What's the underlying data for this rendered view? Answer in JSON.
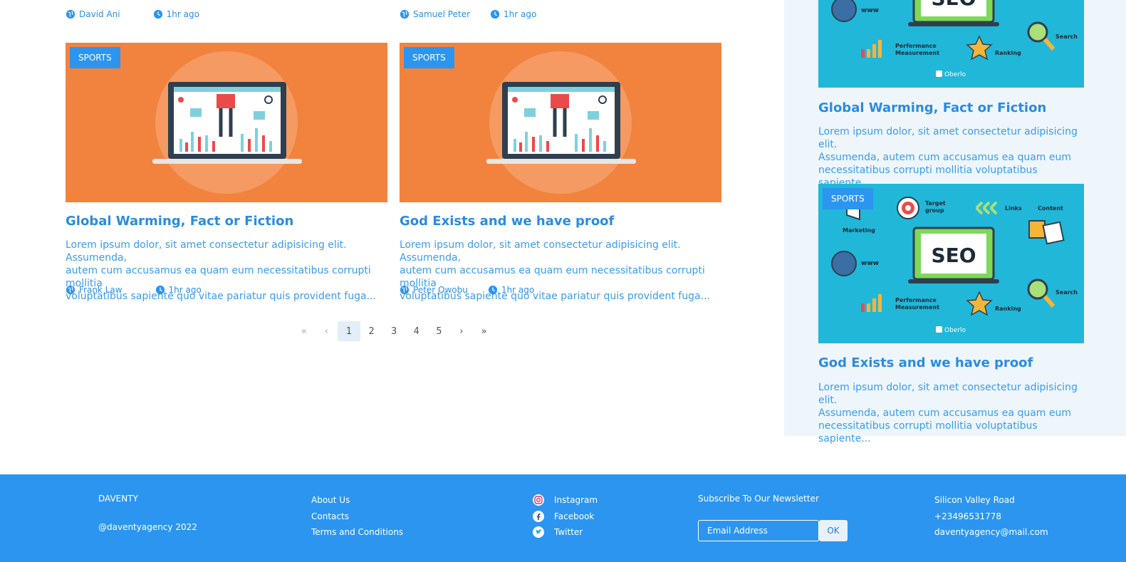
{
  "top_meta": [
    {
      "author": "David Ani",
      "time": "1hr ago"
    },
    {
      "author": "Samuel Peter",
      "time": "1hr ago"
    }
  ],
  "cards": [
    {
      "category": "SPORTS",
      "title": "Global Warming, Fact or Fiction",
      "excerpt_lines": [
        "Lorem ipsum dolor, sit amet consectetur adipisicing elit. Assumenda,",
        "autem cum accusamus ea quam eum necessitatibus corrupti mollitia",
        "voluptatibus sapiente quo vitae pariatur quis provident fuga..."
      ],
      "author": "Frank Law",
      "time": "1hr ago"
    },
    {
      "category": "SPORTS",
      "title": "God Exists and we have proof",
      "excerpt_lines": [
        "Lorem ipsum dolor, sit amet consectetur adipisicing elit. Assumenda,",
        "autem cum accusamus ea quam eum necessitatibus corrupti mollitia",
        "voluptatibus sapiente quo vitae pariatur quis provident fuga..."
      ],
      "author": "Peter Owobu",
      "time": "1hr ago"
    }
  ],
  "pagination": {
    "first": "«",
    "prev": "‹",
    "pages": [
      "1",
      "2",
      "3",
      "4",
      "5"
    ],
    "active": "1",
    "next": "›",
    "last": "»"
  },
  "sidebar": {
    "posts": [
      {
        "category": "",
        "title": "Global Warming, Fact or Fiction",
        "excerpt_lines": [
          "Lorem ipsum dolor, sit amet consectetur adipisicing elit.",
          "Assumenda, autem cum accusamus ea quam eum",
          "necessitatibus corrupti mollitia voluptatibus sapiente..."
        ],
        "image_text": {
          "main": "SEO",
          "www": "www",
          "perf": "Performance",
          "meas": "Measurement",
          "ranking": "Ranking",
          "search": "Search",
          "brand": "Oberlo"
        }
      },
      {
        "category": "SPORTS",
        "title": "God Exists and we have proof",
        "excerpt_lines": [
          "Lorem ipsum dolor, sit amet consectetur adipisicing elit.",
          "Assumenda, autem cum accusamus ea quam eum",
          "necessitatibus corrupti mollitia voluptatibus sapiente..."
        ],
        "image_text": {
          "main": "SEO",
          "www": "www",
          "perf": "Performance",
          "meas": "Measurement",
          "ranking": "Ranking",
          "search": "Search",
          "brand": "Oberlo",
          "target": "Target",
          "group": "group",
          "links": "Links",
          "content": "Content",
          "marketing": "Marketing"
        }
      }
    ]
  },
  "footer": {
    "brand": "DAVENTY",
    "handle": "@daventyagency 2022",
    "links": [
      "About Us",
      "Contacts",
      "Terms and Conditions"
    ],
    "social": [
      {
        "label": "Instagram",
        "icon": "instagram-icon"
      },
      {
        "label": "Facebook",
        "icon": "facebook-icon"
      },
      {
        "label": "Twitter",
        "icon": "twitter-icon"
      }
    ],
    "newsletter": {
      "title": "Subscribe To Our Newsletter",
      "placeholder": "Email Address",
      "button": "OK"
    },
    "contact": {
      "address": "Silicon Valley Road",
      "phone": "+23496531778",
      "email": "daventyagency@mail.com"
    }
  },
  "colors": {
    "accent": "#2b95f0",
    "card_orange": "#f1833f",
    "seo_teal": "#21b7d8",
    "sidebar_bg": "#eef6fc"
  }
}
